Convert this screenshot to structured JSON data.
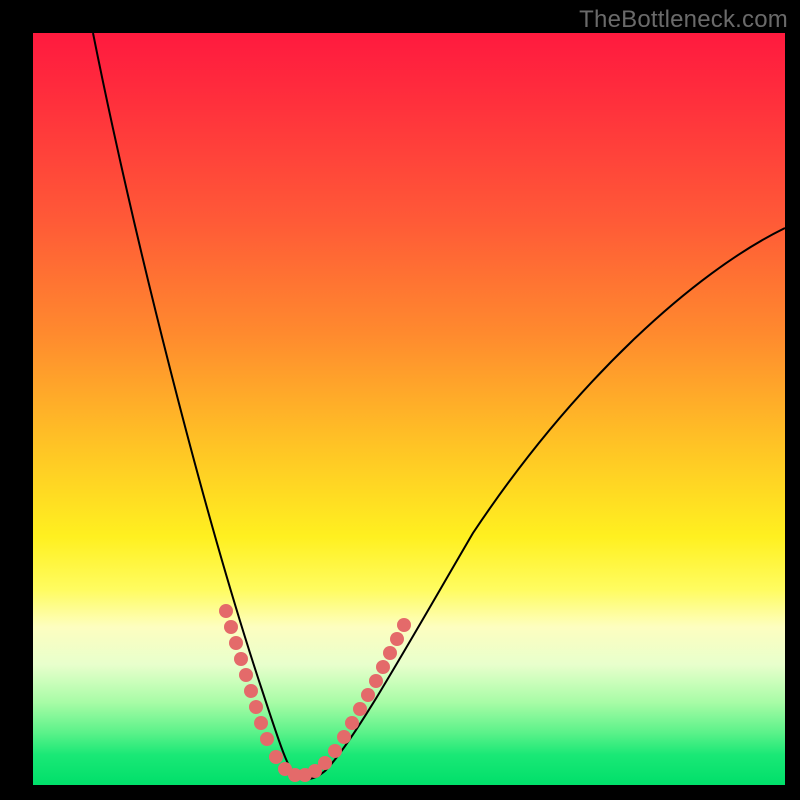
{
  "watermark": {
    "text": "TheBottleneck.com"
  },
  "chart_data": {
    "type": "line",
    "title": "",
    "xlabel": "",
    "ylabel": "",
    "xlim": [
      0,
      100
    ],
    "ylim": [
      0,
      100
    ],
    "series": [
      {
        "name": "bottleneck-curve",
        "x": [
          8,
          12,
          16,
          20,
          24,
          27,
          29,
          31,
          33,
          34,
          36,
          40,
          44,
          48,
          54,
          60,
          68,
          78,
          90,
          100
        ],
        "y": [
          100,
          80,
          60,
          43,
          28,
          18,
          12,
          8,
          4,
          2,
          2,
          4,
          8,
          14,
          22,
          32,
          44,
          56,
          67,
          74
        ]
      }
    ],
    "markers": {
      "name": "highlight-points",
      "color": "#e46a6a",
      "x": [
        25.5,
        26.2,
        27.0,
        27.6,
        28.2,
        28.8,
        29.4,
        30.0,
        30.8,
        32.0,
        33.2,
        34.4,
        35.6,
        36.8,
        38.0,
        39.4,
        40.6,
        41.6,
        42.6,
        43.6,
        44.6,
        45.6,
        46.4,
        47.2,
        48.0
      ],
      "y": [
        22,
        20,
        17,
        15,
        13,
        11,
        9,
        7,
        5,
        3,
        2,
        2,
        2,
        2.5,
        3.5,
        5,
        7,
        9,
        11,
        13.5,
        16,
        18.5,
        20.5,
        22.5,
        24.5
      ]
    },
    "background_gradient": {
      "top": "#ff1a3e",
      "mid": "#ffe020",
      "bottom": "#00df6a"
    }
  }
}
